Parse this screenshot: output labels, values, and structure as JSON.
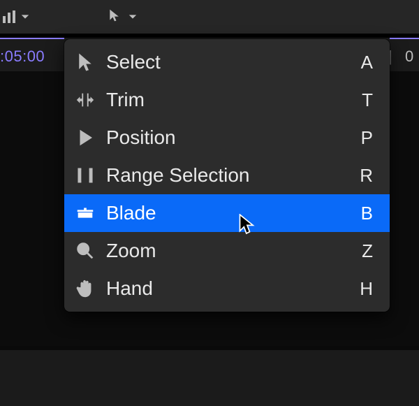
{
  "toolbar": {
    "active_tool_icon": "pointer-icon"
  },
  "ruler": {
    "time_left": ":05:00",
    "tick_separator": "|",
    "time_right_fragment": "0"
  },
  "tool_menu": {
    "items": [
      {
        "icon": "pointer-icon",
        "label": "Select",
        "shortcut": "A",
        "selected": false
      },
      {
        "icon": "trim-icon",
        "label": "Trim",
        "shortcut": "T",
        "selected": false
      },
      {
        "icon": "position-icon",
        "label": "Position",
        "shortcut": "P",
        "selected": false
      },
      {
        "icon": "range-selection-icon",
        "label": "Range Selection",
        "shortcut": "R",
        "selected": false
      },
      {
        "icon": "blade-icon",
        "label": "Blade",
        "shortcut": "B",
        "selected": true
      },
      {
        "icon": "zoom-icon",
        "label": "Zoom",
        "shortcut": "Z",
        "selected": false
      },
      {
        "icon": "hand-icon",
        "label": "Hand",
        "shortcut": "H",
        "selected": false
      }
    ]
  },
  "colors": {
    "accent_selection": "#0a6af8",
    "playhead": "#8a7cff",
    "panel_bg": "#2c2c2c",
    "toolbar_bg": "#262626",
    "body_bg": "#0c0c0c"
  }
}
